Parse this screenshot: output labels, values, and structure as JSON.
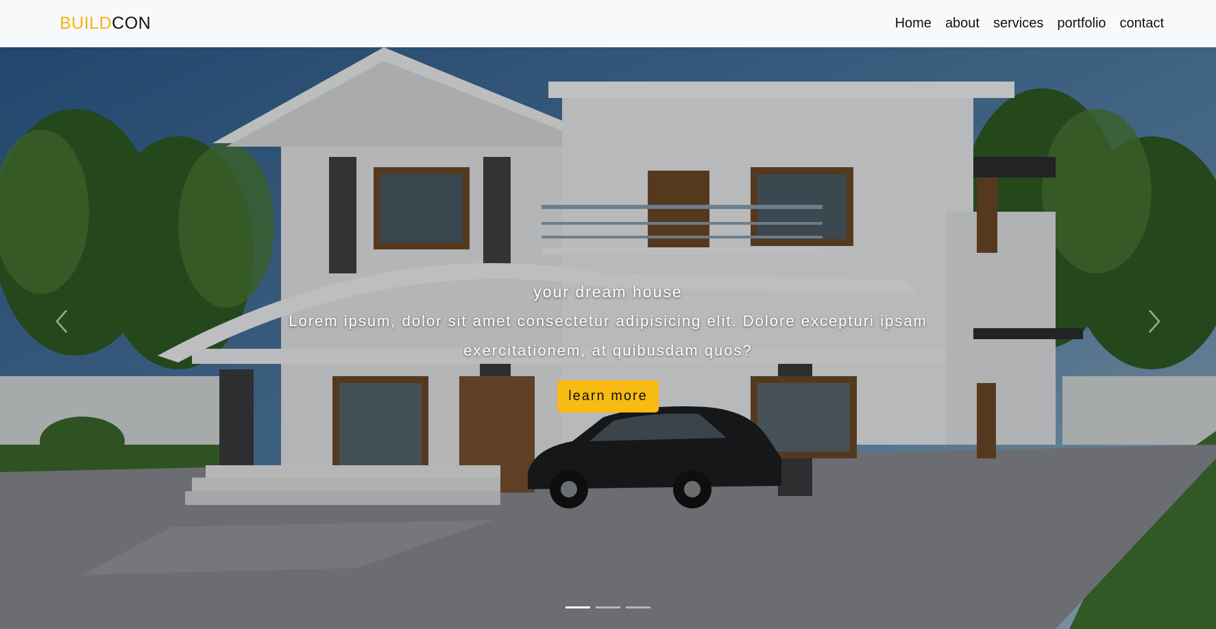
{
  "brand": {
    "part1": "BUILD",
    "part2": "CON"
  },
  "nav": {
    "items": [
      {
        "label": "Home"
      },
      {
        "label": "about"
      },
      {
        "label": "services"
      },
      {
        "label": "portfolio"
      },
      {
        "label": "contact"
      }
    ]
  },
  "hero": {
    "headline": "your dream house",
    "lead": "Lorem ipsum, dolor sit amet consectetur adipisicing elit. Dolore excepturi ipsam exercitationem, at quibusdam quos?",
    "cta_label": "learn more",
    "slide_count": 3,
    "active_slide": 1
  },
  "colors": {
    "accent": "#f6b40e",
    "navbar_bg": "#f8f9fa",
    "button": "#f8bb14"
  },
  "icons": {
    "prev": "chevron-left-icon",
    "next": "chevron-right-icon"
  }
}
